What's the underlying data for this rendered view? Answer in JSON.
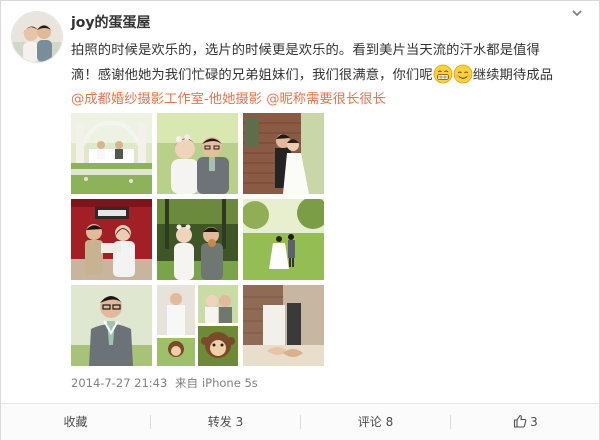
{
  "post": {
    "username": "joy的蛋蛋屋",
    "text_line1": "拍照的时候是欢乐的，选片的时候更是欢乐的。看到美片当天流的汗水都是值得",
    "text_line2_before": "滴！感谢他她为我们忙碌的兄弟姐妹们，我们很满意，你们呢",
    "text_line2_after": "继续期待成品",
    "emoticons": [
      "grin-emoticon-icon",
      "smile-emoticon-icon"
    ],
    "mention1": "@成都婚纱摄影工作室-他她摄影",
    "mention2": "@昵称需要很长很长",
    "timestamp": "2014-7-27 21:43",
    "source_prefix": "来自",
    "source_device": "iPhone 5s"
  },
  "photos": [
    {
      "name": "photo-1",
      "scene": "outdoor-wedding-table-setup"
    },
    {
      "name": "photo-2",
      "scene": "couple-smiling-closeup"
    },
    {
      "name": "photo-3",
      "scene": "couple-kissing-by-brick-wall"
    },
    {
      "name": "photo-4",
      "scene": "couple-holding-sign-red-backdrop"
    },
    {
      "name": "photo-5",
      "scene": "couple-eating-in-forest"
    },
    {
      "name": "photo-6",
      "scene": "couple-walking-on-lawn"
    },
    {
      "name": "photo-7",
      "scene": "groom-portrait"
    },
    {
      "name": "photo-8",
      "scene": "collage-couple-and-plush-monkey"
    },
    {
      "name": "photo-9",
      "scene": "couple-holding-hands-by-wall"
    }
  ],
  "actions": {
    "favorite": "收藏",
    "repost": "转发 3",
    "comment": "评论 8",
    "like_count": "3"
  },
  "icons": {
    "menu": "chevron-down-icon",
    "like": "thumbs-up-icon"
  },
  "colors": {
    "mention": "#eb7350",
    "meta": "#808080",
    "text": "#333333"
  }
}
